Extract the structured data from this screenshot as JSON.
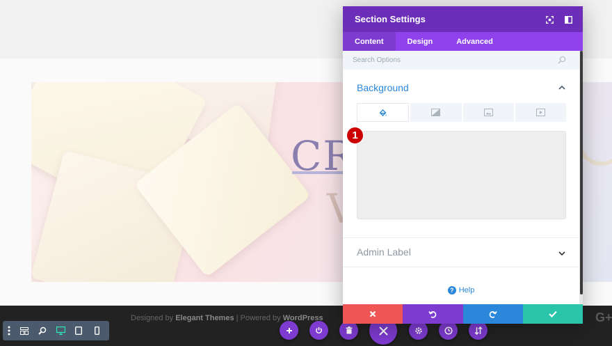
{
  "hero": {
    "line1": "CR",
    "line2": "V"
  },
  "footer": {
    "prefix": "Designed by ",
    "brand": "Elegant Themes",
    "separator": " | Powered by ",
    "platform": "WordPress",
    "social_glyph": "G+"
  },
  "modal": {
    "title": "Section Settings",
    "tabs": [
      {
        "label": "Content",
        "active": true
      },
      {
        "label": "Design",
        "active": false
      },
      {
        "label": "Advanced",
        "active": false
      }
    ],
    "search": {
      "placeholder": "Search Options"
    },
    "background": {
      "title": "Background",
      "tab_icons": [
        "paint-bucket-icon",
        "gradient-icon",
        "image-icon",
        "video-icon"
      ],
      "active_tab": "paint-bucket-icon"
    },
    "step_badge": "1",
    "admin_label": {
      "title": "Admin Label"
    },
    "help": {
      "label": "Help",
      "icon_glyph": "?"
    },
    "actions": [
      {
        "name": "discard",
        "icon": "close-icon",
        "color": "#ef5555"
      },
      {
        "name": "undo",
        "icon": "undo-icon",
        "color": "#7e3bd0"
      },
      {
        "name": "redo",
        "icon": "redo-icon",
        "color": "#2b87da"
      },
      {
        "name": "save",
        "icon": "check-icon",
        "color": "#29c4a9"
      }
    ]
  },
  "colors": {
    "header_purple": "#6c2eb9",
    "tab_purple": "#8f42ec",
    "accent_blue": "#2b87da",
    "badge_red": "#cc0000",
    "toolbar_slate": "#4b5a6c"
  }
}
